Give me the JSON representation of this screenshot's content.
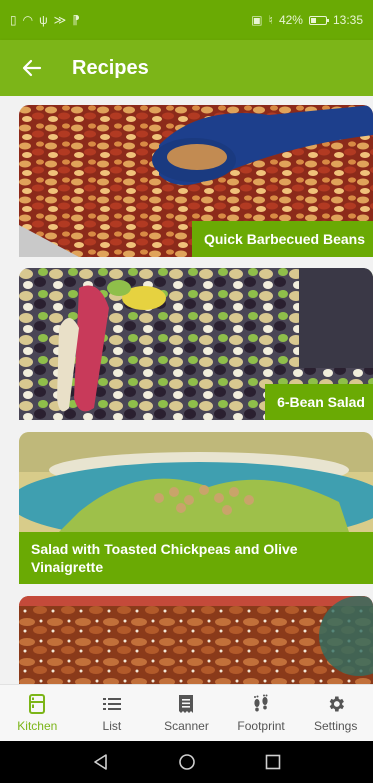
{
  "status_bar": {
    "battery_percent": "42%",
    "time": "13:35",
    "battery_level": 0.42
  },
  "app_bar": {
    "title": "Recipes",
    "back_icon": "arrow-left-icon"
  },
  "recipes": [
    {
      "title": "Quick Barbecued Beans"
    },
    {
      "title": "6-Bean Salad"
    },
    {
      "title": "Salad with Toasted Chickpeas and Olive Vinaigrette"
    },
    {
      "title": ""
    }
  ],
  "bottom_nav": {
    "items": [
      {
        "label": "Kitchen",
        "icon": "kitchen-icon",
        "active": true
      },
      {
        "label": "List",
        "icon": "list-icon",
        "active": false
      },
      {
        "label": "Scanner",
        "icon": "receipt-icon",
        "active": false
      },
      {
        "label": "Footprint",
        "icon": "footprint-icon",
        "active": false
      },
      {
        "label": "Settings",
        "icon": "gear-icon",
        "active": false
      }
    ]
  },
  "colors": {
    "status_bar": "#6aaa04",
    "app_bar": "#7cb518",
    "label_bg": "#6aaa04",
    "nav_active": "#7cb518",
    "nav_inactive": "#555555"
  }
}
